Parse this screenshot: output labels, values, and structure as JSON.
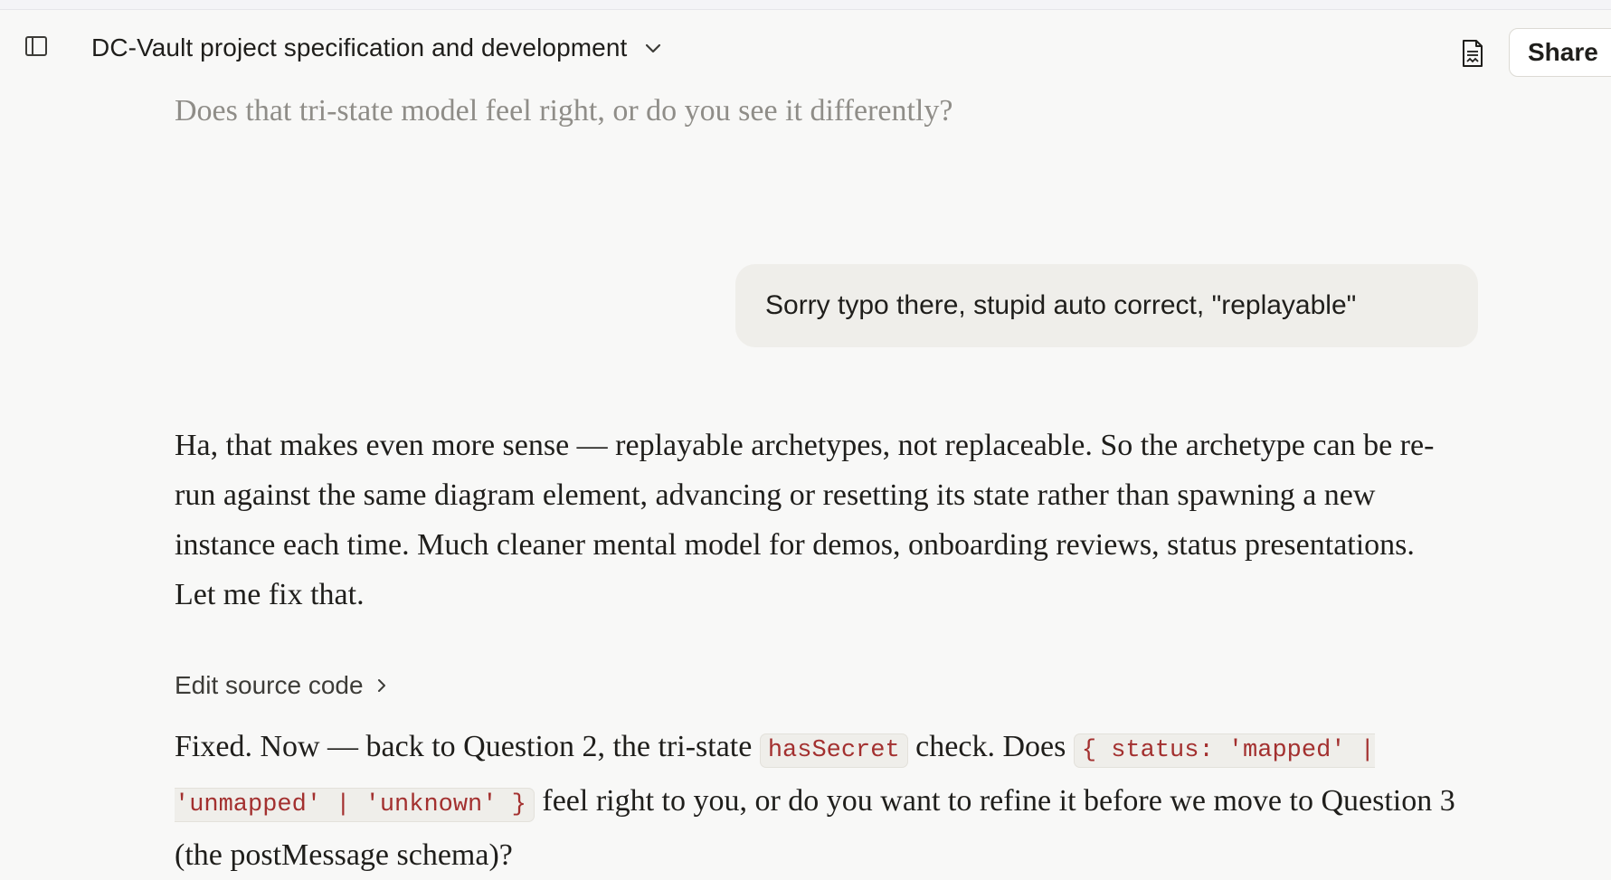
{
  "header": {
    "title": "DC-Vault project specification and development",
    "share_label": "Share",
    "icons": {
      "sidebar": "sidebar-toggle-icon",
      "title_menu": "chevron-down-icon",
      "document": "document-icon"
    }
  },
  "conversation": {
    "previous_line": "Does that tri-state model feel right, or do you see it differently?",
    "user_message": "Sorry typo there, stupid auto correct, \"replayable\"",
    "assistant_paragraph": "Ha, that makes even more sense — replayable archetypes, not replaceable. So the archetype can be re-run against the same diagram element, advancing or resetting its state rather than spawning a new instance each time. Much cleaner mental model for demos, onboarding reviews, status presentations. Let me fix that.",
    "edit_source_label": "Edit source code",
    "final_message": {
      "part1": "Fixed. Now — back to Question 2, the tri-state ",
      "code1": "hasSecret",
      "part2": " check. Does ",
      "code2": "{ status: 'mapped' | 'unmapped' | 'unknown' }",
      "part3": " feel right to you, or do you want to refine it before we move to Question 3 (the postMessage schema)?"
    }
  },
  "colors": {
    "background": "#f8f8f7",
    "user_bubble": "#efeeea",
    "code_text": "#a3302f",
    "muted_text": "#8f8d88"
  }
}
